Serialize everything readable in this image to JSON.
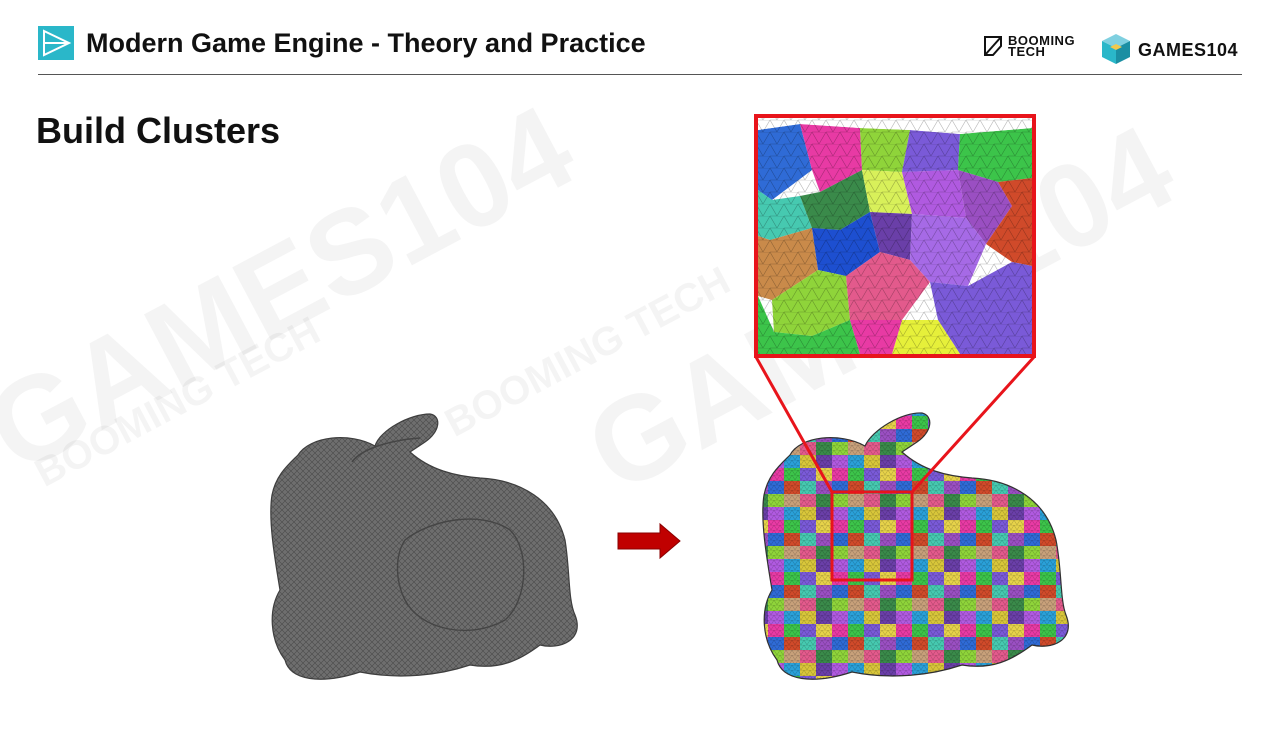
{
  "header": {
    "course_title": "Modern Game Engine - Theory and Practice",
    "brand_booming_line1": "BOOMING",
    "brand_booming_line2": "TECH",
    "brand_games": "GAMES104"
  },
  "slide": {
    "title": "Build Clusters"
  },
  "watermarks": [
    "GAMES104",
    "BOOMING TECH"
  ],
  "colors": {
    "accent_teal": "#2ab7c9",
    "callout_red": "#e8141b",
    "arrow_red": "#c00000",
    "mesh_gray": "#6e6e6e"
  },
  "figure": {
    "left_image": "gray wireframe bunny mesh",
    "right_image": "bunny mesh with colored triangle clusters",
    "zoom_image": "zoomed colored clusters"
  }
}
